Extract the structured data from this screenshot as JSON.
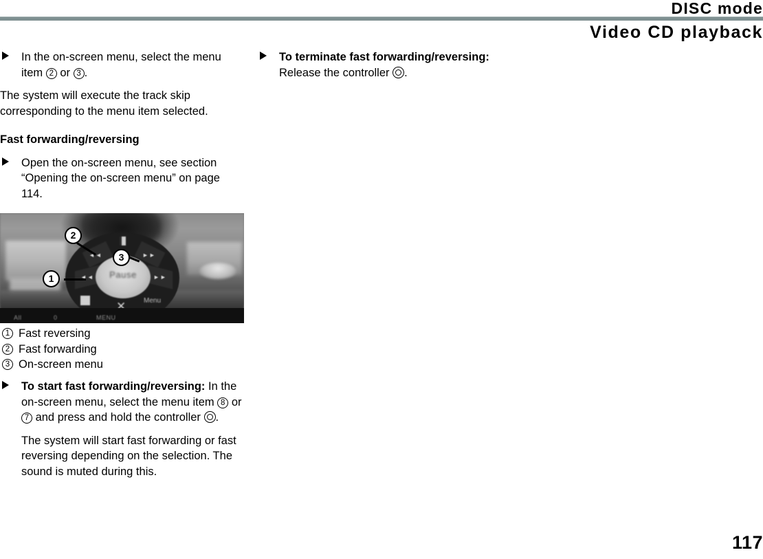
{
  "header": {
    "title": "DISC mode",
    "subtitle": "Video CD playback"
  },
  "left_column": {
    "step_1": {
      "text_before": "In the on-screen menu, select the menu item ",
      "ref_a": "2",
      "text_mid": " or ",
      "ref_b": "3",
      "text_after": "."
    },
    "result_1": "The system will execute the track skip corresponding to the menu item selected.",
    "section_heading": "Fast forwarding/reversing",
    "step_2": "Open the on-screen menu, see section “Opening the on-screen menu” on page 114.",
    "figure": {
      "caption_alt": "On-screen menu with fast reversing, fast forwarding and on-screen menu callouts",
      "osd_center_label": "Pause",
      "osd_menu_label": "Menu",
      "osd_glyph_left": "◄◄",
      "osd_glyph_right": "►►",
      "osd_glyph_upleft": "◄◄",
      "osd_glyph_upright": "►►",
      "strip_left": "All",
      "strip_mid": "0",
      "strip_right": "MENU",
      "callouts": [
        {
          "num": "1",
          "label": "Fast reversing"
        },
        {
          "num": "2",
          "label": "Fast forwarding"
        },
        {
          "num": "3",
          "label": "On-screen menu"
        }
      ]
    },
    "legend": [
      {
        "num": "1",
        "label": "Fast reversing"
      },
      {
        "num": "2",
        "label": "Fast forwarding"
      },
      {
        "num": "3",
        "label": "On-screen menu"
      }
    ],
    "step_3": {
      "bold_lead": "To start fast forwarding/reversing:",
      "text_before": " In the on-screen menu, select the menu item ",
      "ref_a": "8",
      "text_mid": " or ",
      "ref_b": "7",
      "text_after": " and press and hold the controller ",
      "text_end": "."
    },
    "result_2": "The system will start fast forwarding or fast reversing depending on the selection. The sound is muted during this."
  },
  "right_column": {
    "step_1": {
      "bold_lead": "To terminate fast forwarding/reversing:",
      "text_after": " Release the controller ",
      "text_end": "."
    }
  },
  "footer": {
    "page_number": "117"
  },
  "colors": {
    "rule": "#7f9091",
    "text": "#000000",
    "background": "#ffffff"
  }
}
